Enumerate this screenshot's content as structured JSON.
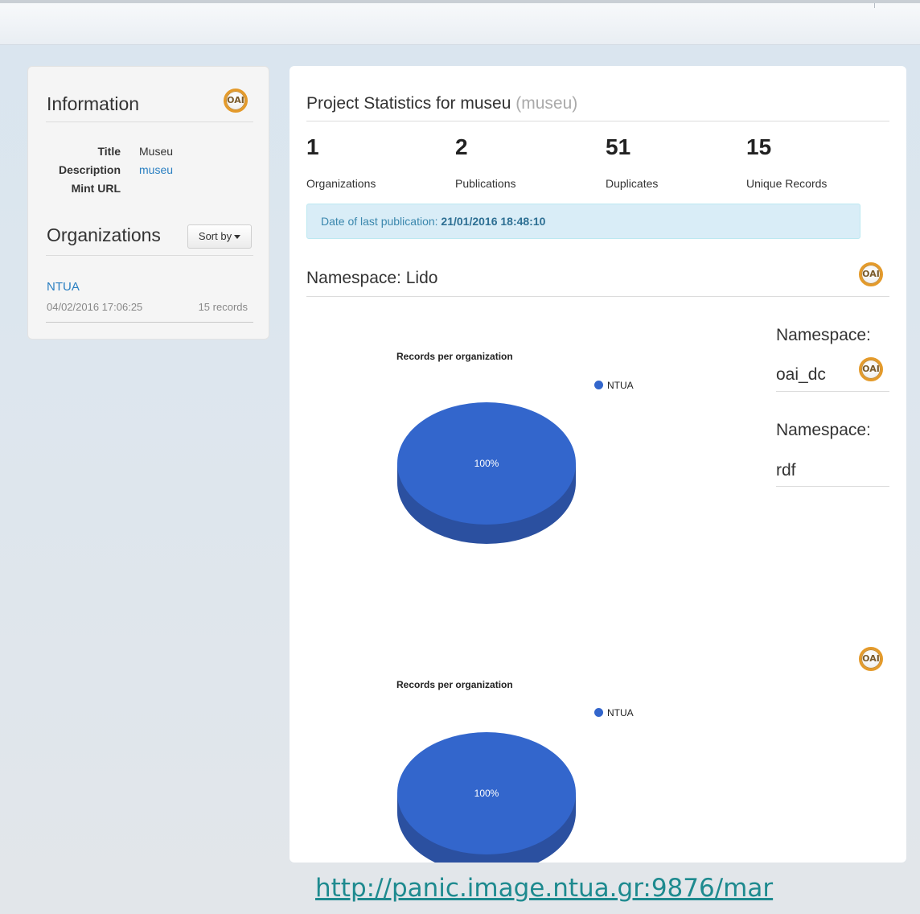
{
  "icons": {
    "oai": "oai-badge-icon",
    "caret": "caret-down-icon"
  },
  "colors": {
    "link": "#2a7fc1",
    "pie": "#3366cc",
    "pie_side": "#2b50a0",
    "alert_bg": "#d9edf7",
    "oai_ring": "#e49a2a"
  },
  "info": {
    "heading": "Information",
    "oai_badge": "OAI",
    "fields": [
      {
        "label": "Title",
        "value": "Museu"
      },
      {
        "label": "Description",
        "value": "museu"
      },
      {
        "label": "Mint URL",
        "value": ""
      }
    ]
  },
  "organizations": {
    "heading": "Organizations",
    "sort_label": "Sort by",
    "items": [
      {
        "name": "NTUA",
        "date": "04/02/2016 17:06:25",
        "records": "15 records"
      }
    ]
  },
  "main": {
    "title_prefix": "Project Statistics for museu",
    "title_muted": "(museu)",
    "stats": [
      {
        "value": "1",
        "label": "Organizations"
      },
      {
        "value": "2",
        "label": "Publications"
      },
      {
        "value": "51",
        "label": "Duplicates"
      },
      {
        "value": "15",
        "label": "Unique Records"
      }
    ],
    "alert_label": "Date of last publication:",
    "alert_value": "21/01/2016 18:48:10",
    "namespace_lido": "Namespace: Lido",
    "namespace_oai_label": "Namespace:",
    "namespace_oai_value": "oai_dc",
    "namespace_rdf_label": "Namespace:",
    "namespace_rdf_value": "rdf"
  },
  "footer_url": "http://panic.image.ntua.gr:9876/mar",
  "chart_data": [
    {
      "type": "pie",
      "title": "Records per organization",
      "categories": [
        "NTUA"
      ],
      "values": [
        100
      ],
      "labels": [
        "100%"
      ],
      "legend": "right"
    },
    {
      "type": "pie",
      "title": "Records per organization",
      "categories": [
        "NTUA"
      ],
      "values": [
        100
      ],
      "labels": [
        "100%"
      ],
      "legend": "right"
    }
  ]
}
